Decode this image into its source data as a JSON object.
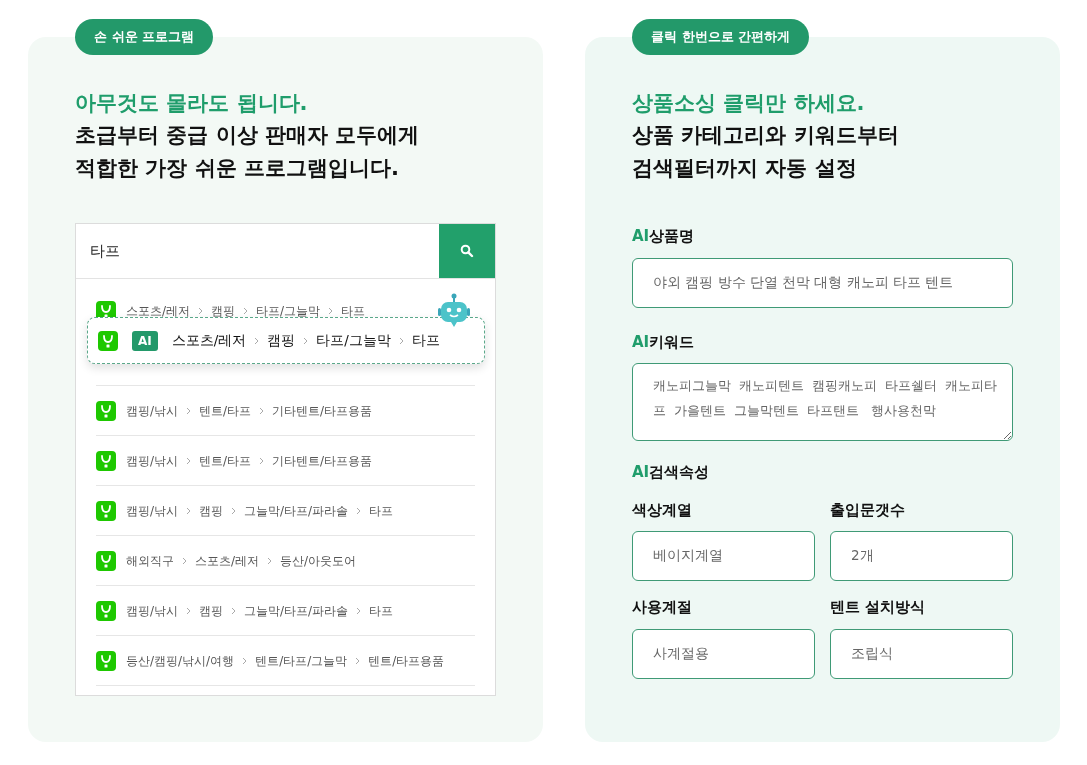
{
  "left_panel": {
    "badge": "손 쉬운 프로그램",
    "headline": "아무것도 몰라도 됩니다.",
    "subhead_lines": [
      "초급부터 중급 이상 판매자 모두에게",
      "적합한 가장 쉬운 프로그램입니다."
    ],
    "search": {
      "value": "타프"
    },
    "ai_suggestion": {
      "badge": "AI",
      "path": [
        "스포츠/레저",
        "캠핑",
        "타프/그늘막",
        "타프"
      ]
    },
    "results": [
      {
        "path": [
          "스포츠/레저",
          "캠핑",
          "타프/그늘막",
          "타프"
        ]
      },
      {
        "path": [
          "캠핑/낚시",
          "텐트/타프",
          "기타텐트/타프용품"
        ]
      },
      {
        "path": [
          "캠핑/낚시",
          "텐트/타프",
          "기타텐트/타프용품"
        ]
      },
      {
        "path": [
          "캠핑/낚시",
          "캠핑",
          "그늘막/타프/파라솔",
          "타프"
        ]
      },
      {
        "path": [
          "해외직구",
          "스포츠/레저",
          "등산/아웃도어"
        ]
      },
      {
        "path": [
          "캠핑/낚시",
          "캠핑",
          "그늘막/타프/파라솔",
          "타프"
        ]
      },
      {
        "path": [
          "등산/캠핑/낚시/여행",
          "텐트/타프/그늘막",
          "텐트/타프용품"
        ]
      }
    ]
  },
  "right_panel": {
    "badge": "클릭 한번으로 간편하게",
    "headline": "상품소싱 클릭만 하세요.",
    "subhead_lines": [
      "상품 카테고리와 키워드부터",
      "검색필터까지 자동 설정"
    ],
    "product_name": {
      "ai_tag": "AI",
      "label": "상품명",
      "value": "야외 캠핑 방수 단열 천막 대형 캐노피 타프 텐트"
    },
    "keywords": {
      "ai_tag": "AI",
      "label": "키워드",
      "value": "캐노피그늘막  캐노피텐트  캠핑캐노피  타프쉘터  캐노피타프  가을텐트  그늘막텐트  타프탠트   행사용천막"
    },
    "search_attributes": {
      "ai_tag": "AI",
      "label": "검색속성",
      "fields": [
        {
          "label": "색상계열",
          "value": "베이지계열"
        },
        {
          "label": "출입문갯수",
          "value": "2개"
        },
        {
          "label": "사용계절",
          "value": "사계절용"
        },
        {
          "label": "텐트 설치방식",
          "value": "조립식"
        }
      ]
    }
  }
}
